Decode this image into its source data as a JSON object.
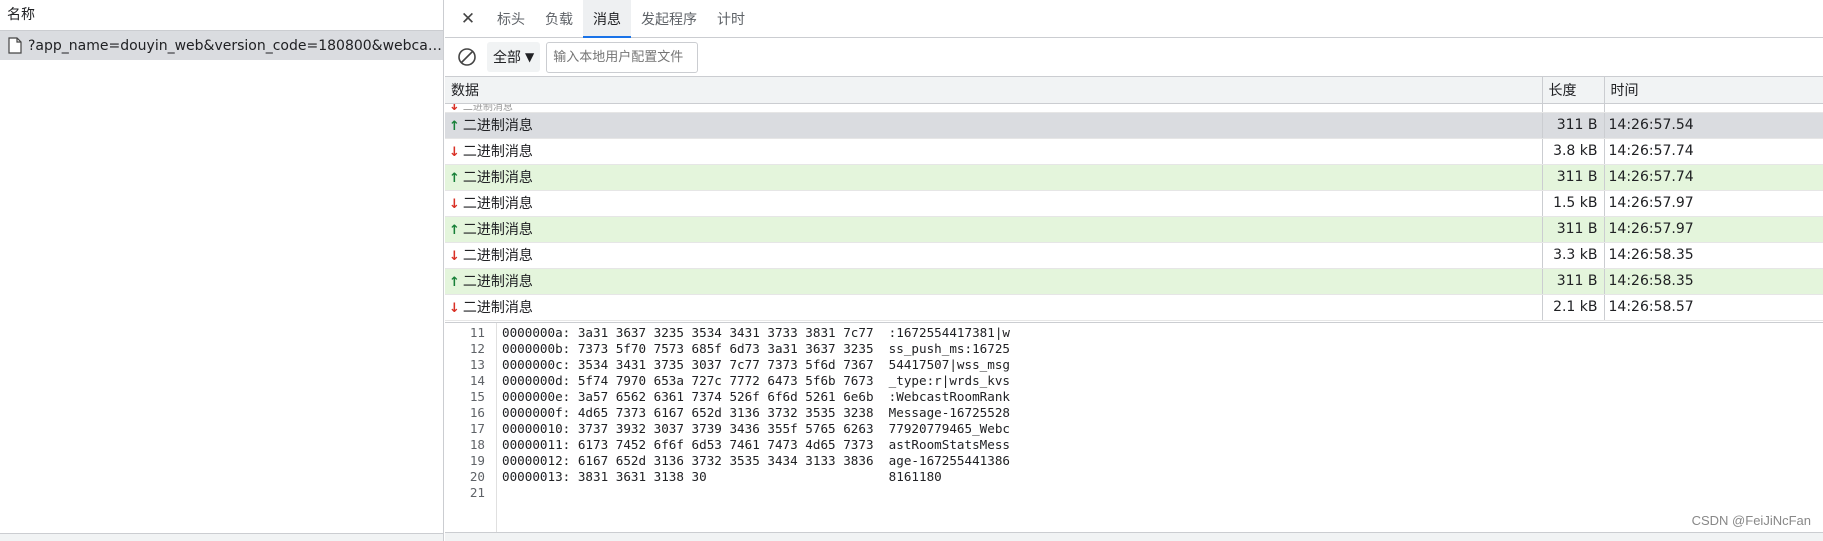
{
  "left_panel": {
    "header": "名称",
    "request_label": "?app_name=douyin_web&version_code=180800&webcast_..."
  },
  "tabs": [
    {
      "label": "标头",
      "active": false
    },
    {
      "label": "负载",
      "active": false
    },
    {
      "label": "消息",
      "active": true
    },
    {
      "label": "发起程序",
      "active": false
    },
    {
      "label": "计时",
      "active": false
    }
  ],
  "toolbar": {
    "filter_value": "全部",
    "search_placeholder": "输入本地用户配置文件"
  },
  "messages_table": {
    "columns": [
      "数据",
      "长度",
      "时间"
    ],
    "partial_row": {
      "direction": "down",
      "data": "二进制消息",
      "length": "",
      "time": ""
    },
    "rows": [
      {
        "direction": "up",
        "data": "二进制消息",
        "length": "311 B",
        "time": "14:26:57.54",
        "selected": true
      },
      {
        "direction": "down",
        "data": "二进制消息",
        "length": "3.8 kB",
        "time": "14:26:57.74"
      },
      {
        "direction": "up",
        "data": "二进制消息",
        "length": "311 B",
        "time": "14:26:57.74"
      },
      {
        "direction": "down",
        "data": "二进制消息",
        "length": "1.5 kB",
        "time": "14:26:57.97"
      },
      {
        "direction": "up",
        "data": "二进制消息",
        "length": "311 B",
        "time": "14:26:57.97"
      },
      {
        "direction": "down",
        "data": "二进制消息",
        "length": "3.3 kB",
        "time": "14:26:58.35"
      },
      {
        "direction": "up",
        "data": "二进制消息",
        "length": "311 B",
        "time": "14:26:58.35"
      },
      {
        "direction": "down",
        "data": "二进制消息",
        "length": "2.1 kB",
        "time": "14:26:58.57"
      }
    ]
  },
  "hex_view": {
    "lines": [
      {
        "n": "11",
        "text": "0000000a: 3a31 3637 3235 3534 3431 3733 3831 7c77  :1672554417381|w"
      },
      {
        "n": "12",
        "text": "0000000b: 7373 5f70 7573 685f 6d73 3a31 3637 3235  ss_push_ms:16725"
      },
      {
        "n": "13",
        "text": "0000000c: 3534 3431 3735 3037 7c77 7373 5f6d 7367  54417507|wss_msg"
      },
      {
        "n": "14",
        "text": "0000000d: 5f74 7970 653a 727c 7772 6473 5f6b 7673  _type:r|wrds_kvs"
      },
      {
        "n": "15",
        "text": "0000000e: 3a57 6562 6361 7374 526f 6f6d 5261 6e6b  :WebcastRoomRank"
      },
      {
        "n": "16",
        "text": "0000000f: 4d65 7373 6167 652d 3136 3732 3535 3238  Message-16725528"
      },
      {
        "n": "17",
        "text": "00000010: 3737 3932 3037 3739 3436 355f 5765 6263  77920779465_Webc"
      },
      {
        "n": "18",
        "text": "00000011: 6173 7452 6f6f 6d53 7461 7473 4d65 7373  astRoomStatsMess"
      },
      {
        "n": "19",
        "text": "00000012: 6167 652d 3136 3732 3535 3434 3133 3836  age-167255441386"
      },
      {
        "n": "20",
        "text": "00000013: 3831 3631 3138 30                        8161180"
      },
      {
        "n": "21",
        "text": ""
      }
    ]
  },
  "watermark": "CSDN @FeiJiNcFan"
}
